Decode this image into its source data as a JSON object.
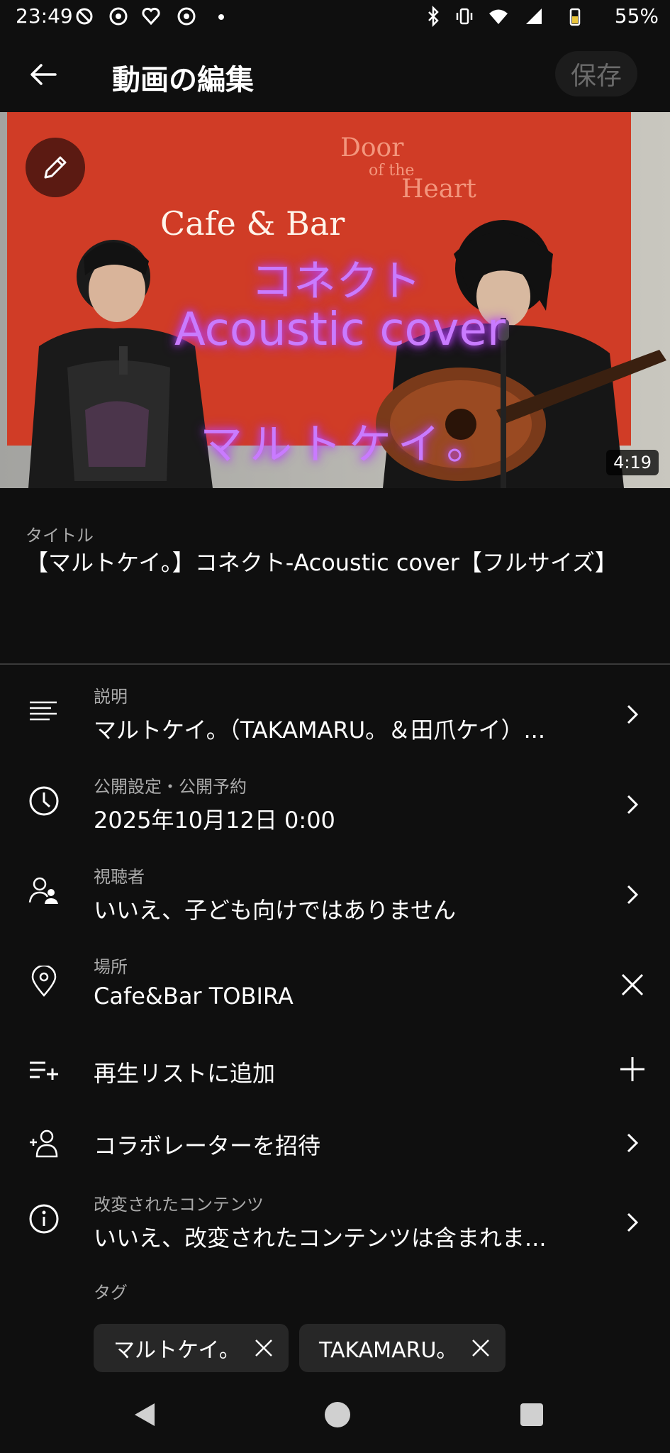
{
  "status": {
    "time": "23:49",
    "battery": "55%"
  },
  "header": {
    "title": "動画の編集",
    "save_label": "保存"
  },
  "thumbnail": {
    "duration": "4:19",
    "overlay_line1": "コネクト",
    "overlay_line2": "Acoustic cover",
    "overlay_line3": "マルトケイ。",
    "banner_cafe": "Cafe & Bar",
    "banner_door": "Door",
    "banner_of": "of the",
    "banner_heart": "Heart"
  },
  "title": {
    "label": "タイトル",
    "value": "【マルトケイ。】コネクト-Acoustic cover【フルサイズ】"
  },
  "rows": {
    "description": {
      "label": "説明",
      "value": "マルトケイ。（TAKAMARU。＆田爪ケイ）..."
    },
    "visibility": {
      "label": "公開設定・公開予約",
      "value": "2025年10月12日 0:00"
    },
    "audience": {
      "label": "視聴者",
      "value": "いいえ、子ども向けではありません"
    },
    "location": {
      "label": "場所",
      "value": "Cafe&Bar TOBIRA"
    },
    "playlist": {
      "value": "再生リストに追加"
    },
    "collaborator": {
      "value": "コラボレーターを招待"
    },
    "altered": {
      "label": "改変されたコンテンツ",
      "value": "いいえ、改変されたコンテンツは含まれま..."
    }
  },
  "tags": {
    "label": "タグ",
    "items": [
      "マルトケイ。",
      "TAKAMARU。"
    ]
  },
  "colors": {
    "background": "#0f0f0f",
    "banner_red": "#d23a24",
    "overlay_purple": "#c97bff"
  }
}
